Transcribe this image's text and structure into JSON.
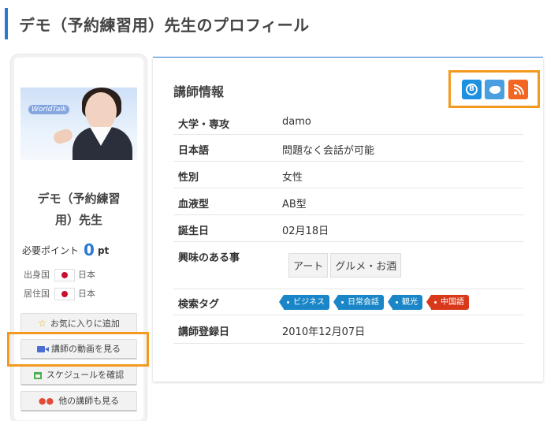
{
  "page": {
    "title": "デモ（予約練習用）先生のプロフィール"
  },
  "sidebar": {
    "photo_logo": "WorldTalk",
    "name": "デモ（予約練習用）先生",
    "name_line1": "デモ（予約練習",
    "name_line2": "用）先生",
    "points_label": "必要ポイント",
    "points_value": "0",
    "points_unit": "pt",
    "origin_label": "出身国",
    "origin_country": "日本",
    "residence_label": "居住国",
    "residence_country": "日本",
    "buttons": {
      "favorite": "お気に入りに追加",
      "video": "講師の動画を見る",
      "schedule": "スケジュールを確認",
      "others": "他の講師も見る"
    }
  },
  "info": {
    "title": "講師情報",
    "share": {
      "hatena": "B!",
      "twitter": "twitter",
      "rss": "rss"
    },
    "rows": [
      {
        "label": "大学・専攻",
        "value": "damo"
      },
      {
        "label": "日本語",
        "value": "問題なく会話が可能"
      },
      {
        "label": "性別",
        "value": "女性"
      },
      {
        "label": "血液型",
        "value": "AB型"
      },
      {
        "label": "誕生日",
        "value": "02月18日"
      },
      {
        "label": "興味のある事",
        "tags": [
          "アート",
          "グルメ・お酒"
        ]
      },
      {
        "label": "検索タグ",
        "tags": [
          "ビジネス",
          "日常会話",
          "観光",
          "中国語"
        ]
      },
      {
        "label": "講師登録日",
        "value": "2010年12月07日"
      }
    ]
  },
  "colors": {
    "accent": "#2a7ad3",
    "highlight": "#f39a1e",
    "tag_blue": "#1a86c8",
    "tag_red": "#d9391b"
  }
}
